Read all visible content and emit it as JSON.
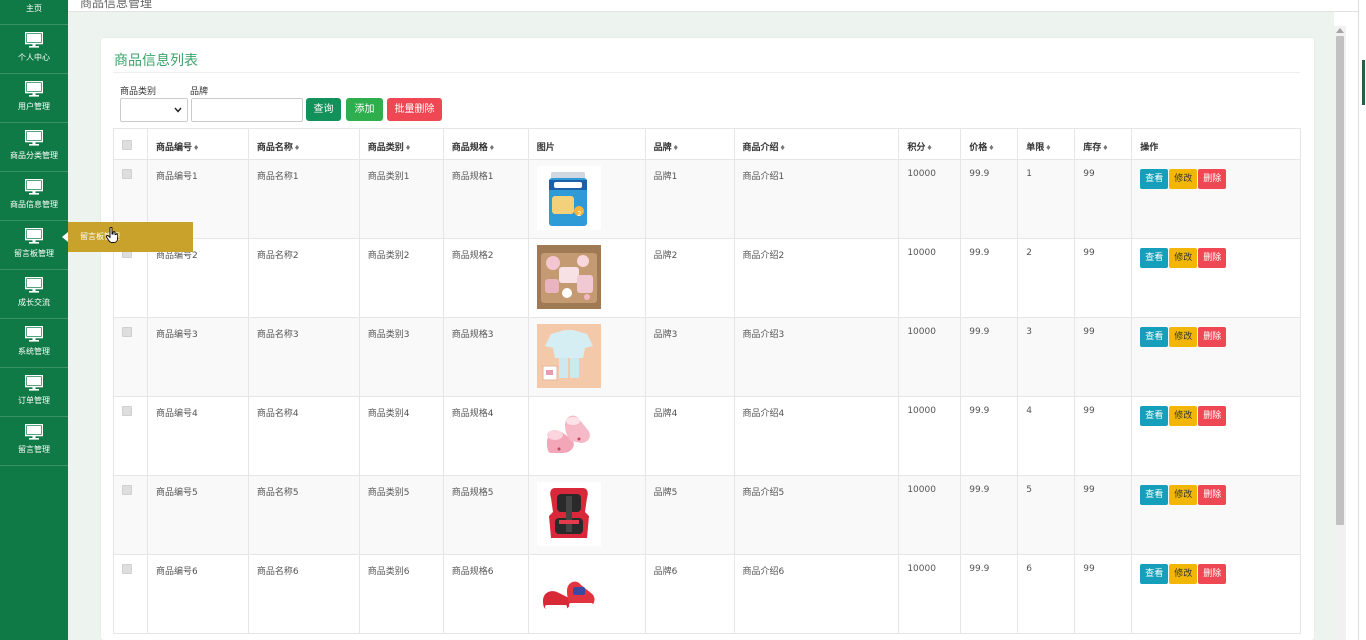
{
  "sidebar": {
    "top_label": "主页",
    "items": [
      {
        "label": "个人中心"
      },
      {
        "label": "用户管理"
      },
      {
        "label": "商品分类管理"
      },
      {
        "label": "商品信息管理"
      },
      {
        "label": "留言板管理"
      },
      {
        "label": "成长交流"
      },
      {
        "label": "系统管理"
      },
      {
        "label": "订单管理"
      },
      {
        "label": "留言管理"
      }
    ],
    "flyout_label": "留言板管理"
  },
  "header": {
    "breadcrumb": "商品信息管理"
  },
  "panel": {
    "title": "商品信息列表",
    "filters": {
      "category_label": "商品类别",
      "brand_label": "品牌",
      "brand_value": "",
      "category_value": ""
    },
    "buttons": {
      "query": "查询",
      "add": "添加",
      "bulk_delete": "批量删除"
    }
  },
  "table": {
    "columns": [
      "商品编号",
      "商品名称",
      "商品类别",
      "商品规格",
      "图片",
      "品牌",
      "商品介绍",
      "积分",
      "价格",
      "单限",
      "库存",
      "操作"
    ],
    "actions": {
      "view": "查看",
      "edit": "修改",
      "delete": "删除"
    },
    "rows": [
      {
        "code": "商品编号1",
        "name": "商品名称1",
        "category": "商品类别1",
        "spec": "商品规格1",
        "image": "milk-formula-can",
        "brand": "品牌1",
        "intro": "商品介绍1",
        "points": "10000",
        "price": "99.9",
        "limit": "1",
        "stock": "99"
      },
      {
        "code": "商品编号2",
        "name": "商品名称2",
        "category": "商品类别2",
        "spec": "商品规格2",
        "image": "baby-clothes-set",
        "brand": "品牌2",
        "intro": "商品介绍2",
        "points": "10000",
        "price": "99.9",
        "limit": "2",
        "stock": "99"
      },
      {
        "code": "商品编号3",
        "name": "商品名称3",
        "category": "商品类别3",
        "spec": "商品规格3",
        "image": "baby-pajamas",
        "brand": "品牌3",
        "intro": "商品介绍3",
        "points": "10000",
        "price": "99.9",
        "limit": "3",
        "stock": "99"
      },
      {
        "code": "商品编号4",
        "name": "商品名称4",
        "category": "商品类别4",
        "spec": "商品规格4",
        "image": "pink-baby-shoes",
        "brand": "品牌4",
        "intro": "商品介绍4",
        "points": "10000",
        "price": "99.9",
        "limit": "4",
        "stock": "99"
      },
      {
        "code": "商品编号5",
        "name": "商品名称5",
        "category": "商品类别5",
        "spec": "商品规格5",
        "image": "car-safety-seat",
        "brand": "品牌5",
        "intro": "商品介绍5",
        "points": "10000",
        "price": "99.9",
        "limit": "5",
        "stock": "99"
      },
      {
        "code": "商品编号6",
        "name": "商品名称6",
        "category": "商品类别6",
        "spec": "商品规格6",
        "image": "red-baby-shoes",
        "brand": "品牌6",
        "intro": "商品介绍6",
        "points": "10000",
        "price": "99.9",
        "limit": "6",
        "stock": "99"
      }
    ]
  },
  "colors": {
    "sidebar": "#0f7a45",
    "accent_title": "#3aa36b",
    "flyout": "#c9a22c",
    "danger": "#ef4753",
    "info": "#169fba",
    "warning": "#f2b705"
  }
}
